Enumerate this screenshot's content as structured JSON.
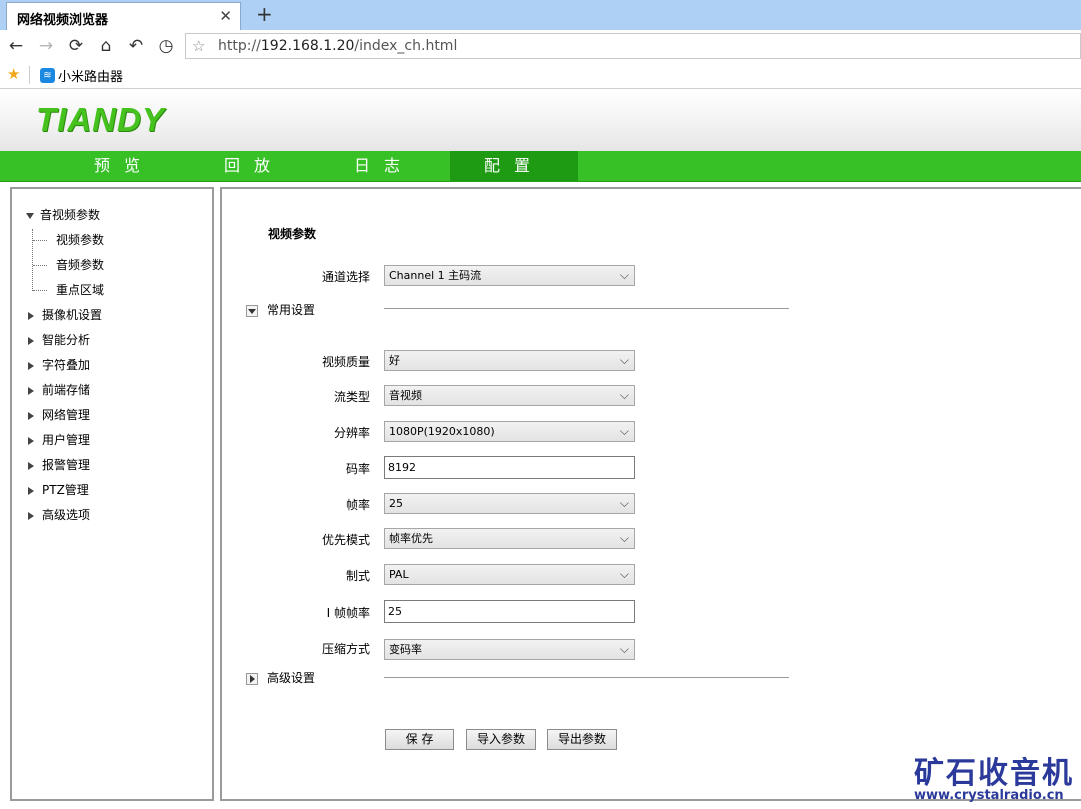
{
  "browser": {
    "tab_title": "网络视频浏览器",
    "tab_close": "✕",
    "new_tab": "+",
    "url_prefix": "http://",
    "url_host": "192.168.1.20",
    "url_path": "/index_ch.html",
    "bookmark_label": "小米路由器"
  },
  "app": {
    "logo": "TIANDY",
    "nav": [
      {
        "label": "预览"
      },
      {
        "label": "回放"
      },
      {
        "label": "日志"
      },
      {
        "label": "配置"
      }
    ],
    "active_nav": "配置"
  },
  "sidebar": {
    "expanded": {
      "label": "音视频参数"
    },
    "children": [
      {
        "label": "视频参数"
      },
      {
        "label": "音频参数"
      },
      {
        "label": "重点区域"
      }
    ],
    "items": [
      {
        "label": "摄像机设置"
      },
      {
        "label": "智能分析"
      },
      {
        "label": "字符叠加"
      },
      {
        "label": "前端存储"
      },
      {
        "label": "网络管理"
      },
      {
        "label": "用户管理"
      },
      {
        "label": "报警管理"
      },
      {
        "label": "PTZ管理"
      },
      {
        "label": "高级选项"
      }
    ]
  },
  "form": {
    "title": "视频参数",
    "channel_label": "通道选择",
    "channel_value": "Channel 1 主码流",
    "common_group": "常用设置",
    "advanced_group": "高级设置",
    "fields": {
      "quality_label": "视频质量",
      "quality_value": "好",
      "stream_label": "流类型",
      "stream_value": "音视频",
      "resolution_label": "分辨率",
      "resolution_value": "1080P(1920x1080)",
      "bitrate_label": "码率",
      "bitrate_value": "8192",
      "fps_label": "帧率",
      "fps_value": "25",
      "priority_label": "优先模式",
      "priority_value": "帧率优先",
      "standard_label": "制式",
      "standard_value": "PAL",
      "iframe_label": "I 帧帧率",
      "iframe_value": "25",
      "compression_label": "压缩方式",
      "compression_value": "变码率"
    },
    "buttons": {
      "save": "保 存",
      "import": "导入参数",
      "export": "导出参数"
    }
  },
  "watermark": {
    "title": "矿石收音机",
    "url": "www.crystalradio.cn"
  },
  "colors": {
    "nav_green": "#37c127",
    "nav_active": "#1e9a13",
    "logo_green": "#46c21e"
  }
}
